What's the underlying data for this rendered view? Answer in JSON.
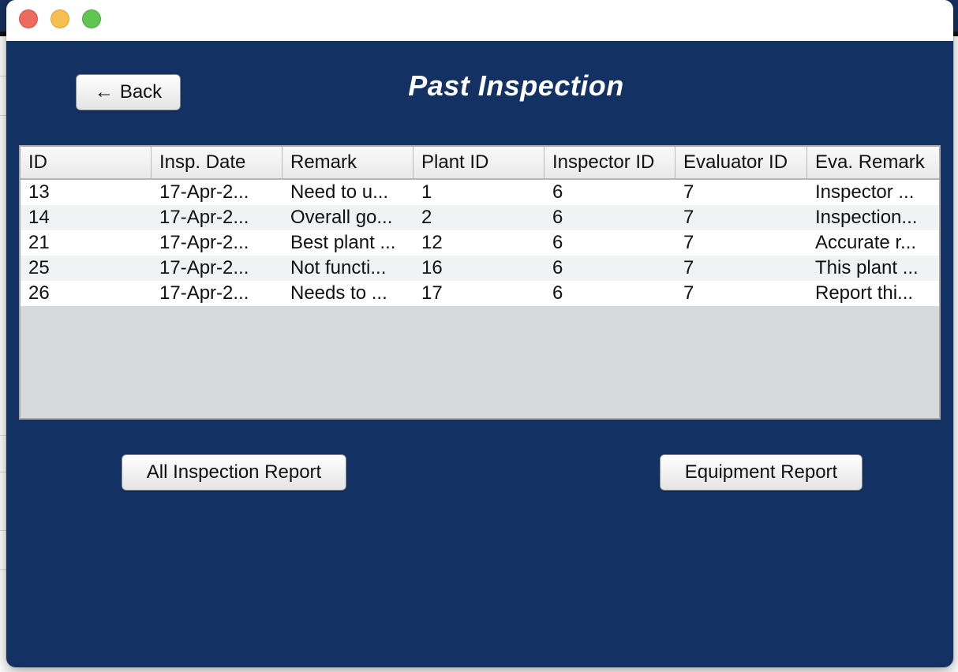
{
  "window": {
    "title": ""
  },
  "header": {
    "back_label": "Back",
    "back_arrow": "←",
    "page_title": "Past Inspection"
  },
  "table": {
    "columns": [
      "ID",
      "Insp. Date",
      "Remark",
      "Plant ID",
      "Inspector ID",
      "Evaluator ID",
      "Eva. Remark"
    ],
    "rows": [
      [
        "13",
        "17-Apr-2...",
        "Need to u...",
        "1",
        "6",
        "7",
        "Inspector ..."
      ],
      [
        "14",
        "17-Apr-2...",
        "Overall go...",
        "2",
        "6",
        "7",
        "Inspection..."
      ],
      [
        "21",
        "17-Apr-2...",
        "Best plant ...",
        "12",
        "6",
        "7",
        "Accurate r..."
      ],
      [
        "25",
        "17-Apr-2...",
        "Not functi...",
        "16",
        "6",
        "7",
        "This plant ..."
      ],
      [
        "26",
        "17-Apr-2...",
        "Needs to ...",
        "17",
        "6",
        "7",
        "Report thi..."
      ]
    ]
  },
  "actions": {
    "all_inspection_report_label": "All Inspection Report",
    "equipment_report_label": "Equipment Report"
  },
  "colors": {
    "content_bg": "#133162",
    "title_text": "#ffffff",
    "close": "#ed6a5e",
    "minimize": "#f5bf4f",
    "zoom": "#61c554"
  },
  "icons": {
    "back": "left-arrow-icon",
    "close": "close-window-icon",
    "minimize": "minimize-window-icon",
    "zoom": "zoom-window-icon"
  }
}
